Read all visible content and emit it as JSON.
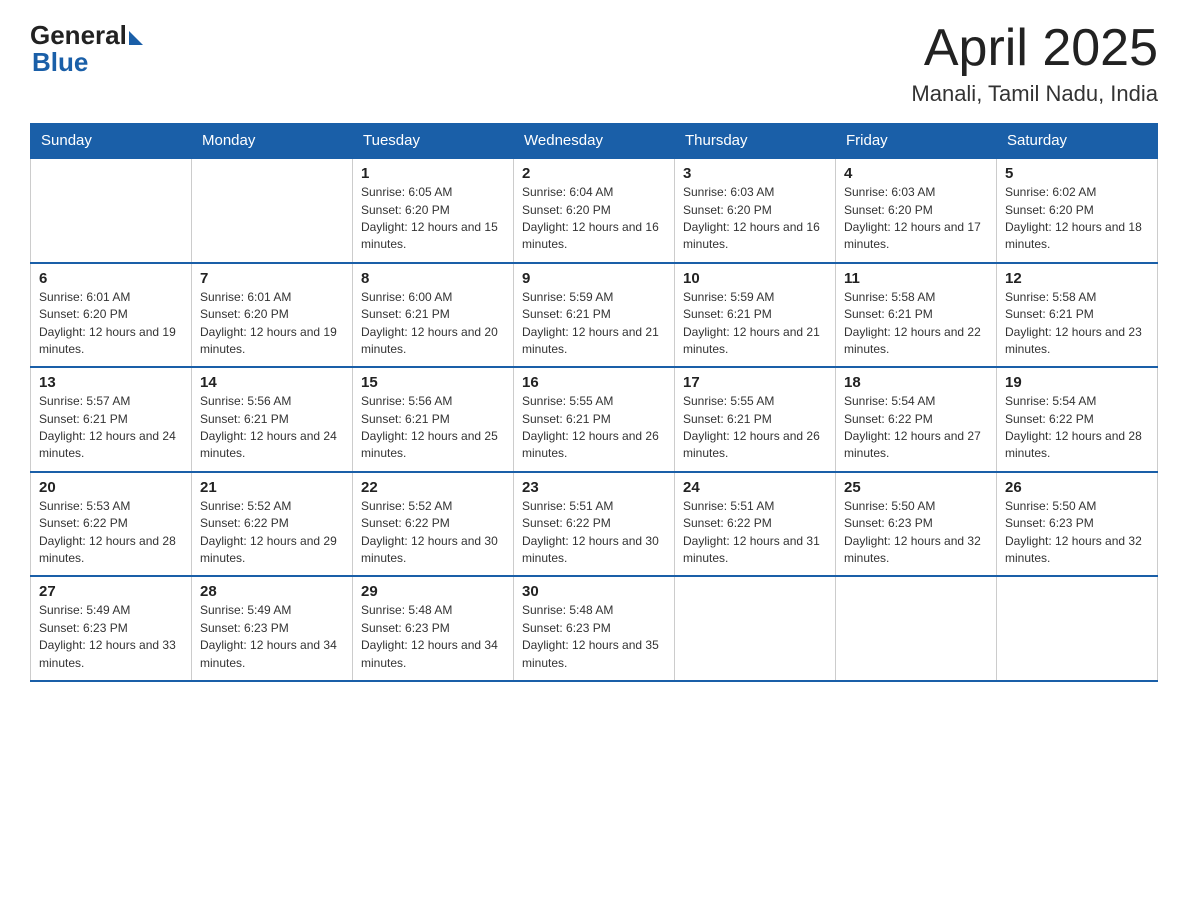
{
  "header": {
    "logo_general": "General",
    "logo_blue": "Blue",
    "title": "April 2025",
    "location": "Manali, Tamil Nadu, India"
  },
  "weekdays": [
    "Sunday",
    "Monday",
    "Tuesday",
    "Wednesday",
    "Thursday",
    "Friday",
    "Saturday"
  ],
  "weeks": [
    [
      {
        "day": "",
        "sunrise": "",
        "sunset": "",
        "daylight": ""
      },
      {
        "day": "",
        "sunrise": "",
        "sunset": "",
        "daylight": ""
      },
      {
        "day": "1",
        "sunrise": "Sunrise: 6:05 AM",
        "sunset": "Sunset: 6:20 PM",
        "daylight": "Daylight: 12 hours and 15 minutes."
      },
      {
        "day": "2",
        "sunrise": "Sunrise: 6:04 AM",
        "sunset": "Sunset: 6:20 PM",
        "daylight": "Daylight: 12 hours and 16 minutes."
      },
      {
        "day": "3",
        "sunrise": "Sunrise: 6:03 AM",
        "sunset": "Sunset: 6:20 PM",
        "daylight": "Daylight: 12 hours and 16 minutes."
      },
      {
        "day": "4",
        "sunrise": "Sunrise: 6:03 AM",
        "sunset": "Sunset: 6:20 PM",
        "daylight": "Daylight: 12 hours and 17 minutes."
      },
      {
        "day": "5",
        "sunrise": "Sunrise: 6:02 AM",
        "sunset": "Sunset: 6:20 PM",
        "daylight": "Daylight: 12 hours and 18 minutes."
      }
    ],
    [
      {
        "day": "6",
        "sunrise": "Sunrise: 6:01 AM",
        "sunset": "Sunset: 6:20 PM",
        "daylight": "Daylight: 12 hours and 19 minutes."
      },
      {
        "day": "7",
        "sunrise": "Sunrise: 6:01 AM",
        "sunset": "Sunset: 6:20 PM",
        "daylight": "Daylight: 12 hours and 19 minutes."
      },
      {
        "day": "8",
        "sunrise": "Sunrise: 6:00 AM",
        "sunset": "Sunset: 6:21 PM",
        "daylight": "Daylight: 12 hours and 20 minutes."
      },
      {
        "day": "9",
        "sunrise": "Sunrise: 5:59 AM",
        "sunset": "Sunset: 6:21 PM",
        "daylight": "Daylight: 12 hours and 21 minutes."
      },
      {
        "day": "10",
        "sunrise": "Sunrise: 5:59 AM",
        "sunset": "Sunset: 6:21 PM",
        "daylight": "Daylight: 12 hours and 21 minutes."
      },
      {
        "day": "11",
        "sunrise": "Sunrise: 5:58 AM",
        "sunset": "Sunset: 6:21 PM",
        "daylight": "Daylight: 12 hours and 22 minutes."
      },
      {
        "day": "12",
        "sunrise": "Sunrise: 5:58 AM",
        "sunset": "Sunset: 6:21 PM",
        "daylight": "Daylight: 12 hours and 23 minutes."
      }
    ],
    [
      {
        "day": "13",
        "sunrise": "Sunrise: 5:57 AM",
        "sunset": "Sunset: 6:21 PM",
        "daylight": "Daylight: 12 hours and 24 minutes."
      },
      {
        "day": "14",
        "sunrise": "Sunrise: 5:56 AM",
        "sunset": "Sunset: 6:21 PM",
        "daylight": "Daylight: 12 hours and 24 minutes."
      },
      {
        "day": "15",
        "sunrise": "Sunrise: 5:56 AM",
        "sunset": "Sunset: 6:21 PM",
        "daylight": "Daylight: 12 hours and 25 minutes."
      },
      {
        "day": "16",
        "sunrise": "Sunrise: 5:55 AM",
        "sunset": "Sunset: 6:21 PM",
        "daylight": "Daylight: 12 hours and 26 minutes."
      },
      {
        "day": "17",
        "sunrise": "Sunrise: 5:55 AM",
        "sunset": "Sunset: 6:21 PM",
        "daylight": "Daylight: 12 hours and 26 minutes."
      },
      {
        "day": "18",
        "sunrise": "Sunrise: 5:54 AM",
        "sunset": "Sunset: 6:22 PM",
        "daylight": "Daylight: 12 hours and 27 minutes."
      },
      {
        "day": "19",
        "sunrise": "Sunrise: 5:54 AM",
        "sunset": "Sunset: 6:22 PM",
        "daylight": "Daylight: 12 hours and 28 minutes."
      }
    ],
    [
      {
        "day": "20",
        "sunrise": "Sunrise: 5:53 AM",
        "sunset": "Sunset: 6:22 PM",
        "daylight": "Daylight: 12 hours and 28 minutes."
      },
      {
        "day": "21",
        "sunrise": "Sunrise: 5:52 AM",
        "sunset": "Sunset: 6:22 PM",
        "daylight": "Daylight: 12 hours and 29 minutes."
      },
      {
        "day": "22",
        "sunrise": "Sunrise: 5:52 AM",
        "sunset": "Sunset: 6:22 PM",
        "daylight": "Daylight: 12 hours and 30 minutes."
      },
      {
        "day": "23",
        "sunrise": "Sunrise: 5:51 AM",
        "sunset": "Sunset: 6:22 PM",
        "daylight": "Daylight: 12 hours and 30 minutes."
      },
      {
        "day": "24",
        "sunrise": "Sunrise: 5:51 AM",
        "sunset": "Sunset: 6:22 PM",
        "daylight": "Daylight: 12 hours and 31 minutes."
      },
      {
        "day": "25",
        "sunrise": "Sunrise: 5:50 AM",
        "sunset": "Sunset: 6:23 PM",
        "daylight": "Daylight: 12 hours and 32 minutes."
      },
      {
        "day": "26",
        "sunrise": "Sunrise: 5:50 AM",
        "sunset": "Sunset: 6:23 PM",
        "daylight": "Daylight: 12 hours and 32 minutes."
      }
    ],
    [
      {
        "day": "27",
        "sunrise": "Sunrise: 5:49 AM",
        "sunset": "Sunset: 6:23 PM",
        "daylight": "Daylight: 12 hours and 33 minutes."
      },
      {
        "day": "28",
        "sunrise": "Sunrise: 5:49 AM",
        "sunset": "Sunset: 6:23 PM",
        "daylight": "Daylight: 12 hours and 34 minutes."
      },
      {
        "day": "29",
        "sunrise": "Sunrise: 5:48 AM",
        "sunset": "Sunset: 6:23 PM",
        "daylight": "Daylight: 12 hours and 34 minutes."
      },
      {
        "day": "30",
        "sunrise": "Sunrise: 5:48 AM",
        "sunset": "Sunset: 6:23 PM",
        "daylight": "Daylight: 12 hours and 35 minutes."
      },
      {
        "day": "",
        "sunrise": "",
        "sunset": "",
        "daylight": ""
      },
      {
        "day": "",
        "sunrise": "",
        "sunset": "",
        "daylight": ""
      },
      {
        "day": "",
        "sunrise": "",
        "sunset": "",
        "daylight": ""
      }
    ]
  ]
}
